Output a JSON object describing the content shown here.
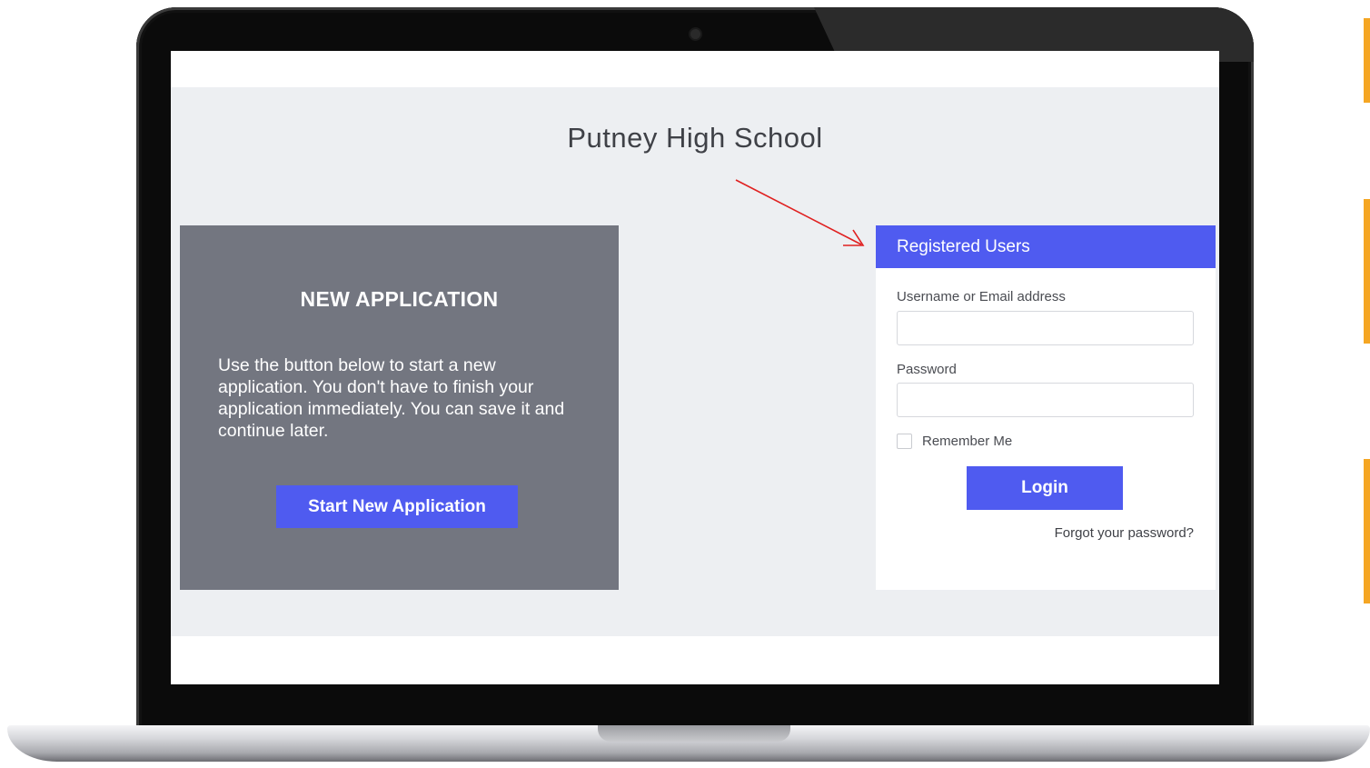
{
  "school": {
    "title": "Putney High School"
  },
  "new_application": {
    "heading": "NEW APPLICATION",
    "description": "Use the button below to start a new application. You don't have to finish your application immediately. You can save it and continue later.",
    "button_label": "Start New Application"
  },
  "login": {
    "header": "Registered Users",
    "username_label": "Username or Email address",
    "username_value": "",
    "password_label": "Password",
    "password_value": "",
    "remember_label": "Remember Me",
    "remember_checked": false,
    "login_button": "Login",
    "forgot_link": "Forgot your password?"
  },
  "colors": {
    "accent_blue": "#4f5bf0",
    "card_gray": "#737680",
    "page_background": "#edeff2",
    "arrow_red": "#e02020",
    "side_accent_orange": "#f5a623"
  },
  "icons": {
    "annotation": "red-arrow-icon",
    "camera": "webcam-icon"
  }
}
